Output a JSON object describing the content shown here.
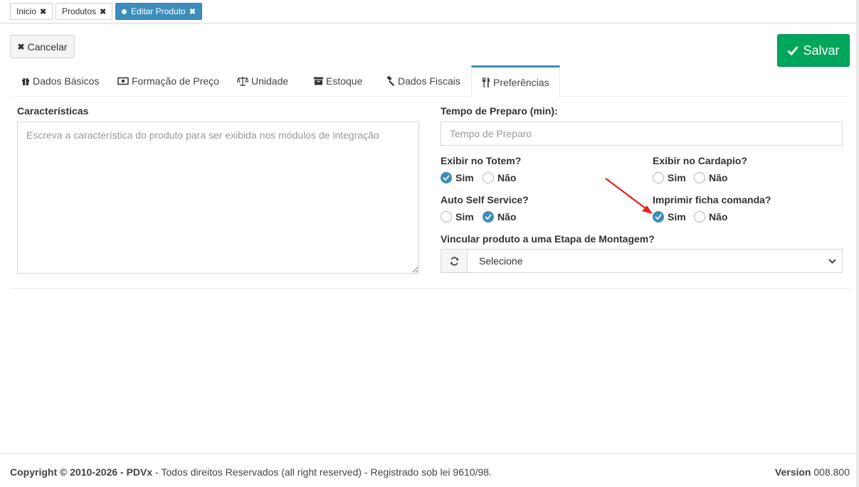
{
  "page_tabs": [
    {
      "label": "Inicio"
    },
    {
      "label": "Produtos"
    },
    {
      "label": "Editar Produto"
    }
  ],
  "toolbar": {
    "cancel_label": "Cancelar",
    "save_label": "Salvar"
  },
  "section_tabs": [
    {
      "label": "Dados Básicos",
      "icon": "gift-icon"
    },
    {
      "label": "Formação de Preço",
      "icon": "money-bill-icon"
    },
    {
      "label": "Unidade",
      "icon": "balance-scale-icon"
    },
    {
      "label": "Estoque",
      "icon": "archive-icon"
    },
    {
      "label": "Dados Fiscais",
      "icon": "gavel-icon"
    },
    {
      "label": "Preferências",
      "icon": "cutlery-icon",
      "active": true
    }
  ],
  "form": {
    "caracteristicas": {
      "label": "Características",
      "placeholder": "Escreva a característica do produto para ser exibida nos módulos de integração",
      "value": ""
    },
    "tempo_preparo": {
      "label": "Tempo de Preparo (min):",
      "placeholder": "Tempo de Preparo",
      "value": ""
    },
    "exibir_totem": {
      "label": "Exibir no Totem?",
      "yes": "Sim",
      "no": "Não",
      "selected": "Sim"
    },
    "exibir_cardapio": {
      "label": "Exibir no Cardapio?",
      "yes": "Sim",
      "no": "Não",
      "selected": null
    },
    "auto_self_service": {
      "label": "Auto Self Service?",
      "yes": "Sim",
      "no": "Não",
      "selected": "Não"
    },
    "imprimir_ficha": {
      "label": "Imprimir ficha comanda?",
      "yes": "Sim",
      "no": "Não",
      "selected": "Sim"
    },
    "etapa_montagem": {
      "label": "Vincular produto a uma Etapa de Montagem?",
      "selected": "Selecione"
    }
  },
  "footer": {
    "copyright_prefix": "Copyright © 2010-2026 - ",
    "brand": "PDVx",
    "copyright_suffix": " - Todos direitos Reservados (all right reserved) - Registrado sob lei 9610/98.",
    "version_label": "Version",
    "version_value": " 008.800"
  },
  "colors": {
    "primary": "#3c8dbc",
    "success": "#00a65a",
    "annotation_arrow": "#e8201e"
  }
}
